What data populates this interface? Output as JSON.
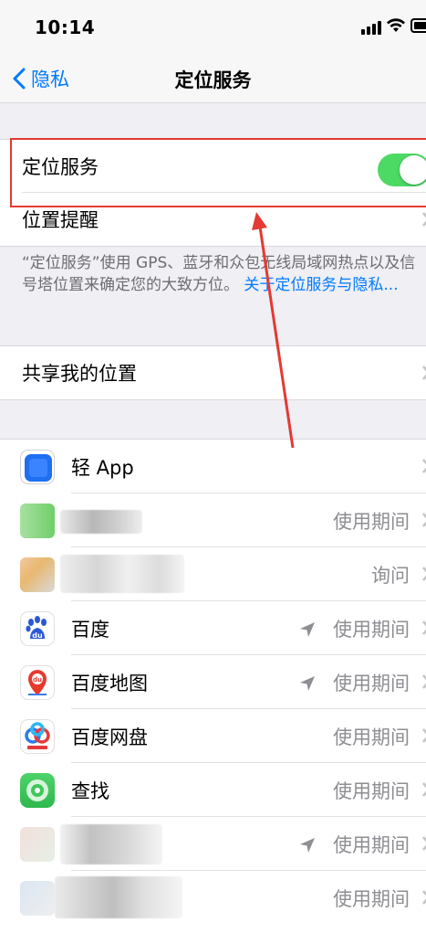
{
  "status_bar": {
    "time": "10:14"
  },
  "nav": {
    "back_label": "隐私",
    "title": "定位服务"
  },
  "main": {
    "location_services": {
      "label": "定位服务",
      "enabled": true
    },
    "location_alerts": {
      "label": "位置提醒"
    },
    "note": "“定位服务”使用 GPS、蓝牙和众包无线局域网热点以及信号塔位置来确定您的大致方位。",
    "note_link": "关于定位服务与隐私...",
    "share_location": {
      "label": "共享我的位置"
    }
  },
  "apps": [
    {
      "name": "轻 App",
      "value": "",
      "icon": "light-app-icon",
      "location_arrow": false
    },
    {
      "name": "",
      "value": "使用期间",
      "icon": "blurred-app-icon",
      "location_arrow": false
    },
    {
      "name": "",
      "value": "询问",
      "icon": "blurred-app-icon",
      "location_arrow": false
    },
    {
      "name": "百度",
      "value": "使用期间",
      "icon": "baidu-icon",
      "location_arrow": true
    },
    {
      "name": "百度地图",
      "value": "使用期间",
      "icon": "baidu-map-icon",
      "location_arrow": true
    },
    {
      "name": "百度网盘",
      "value": "使用期间",
      "icon": "baidu-netdisk-icon",
      "location_arrow": false
    },
    {
      "name": "查找",
      "value": "使用期间",
      "icon": "find-my-icon",
      "location_arrow": false
    },
    {
      "name": "",
      "value": "使用期间",
      "icon": "blurred-app-icon",
      "location_arrow": true
    },
    {
      "name": "",
      "value": "使用期间",
      "icon": "blurred-app-icon",
      "location_arrow": false
    }
  ],
  "colors": {
    "accent": "#007aff",
    "toggle_on": "#4cd964",
    "annotation": "#e33a32"
  }
}
